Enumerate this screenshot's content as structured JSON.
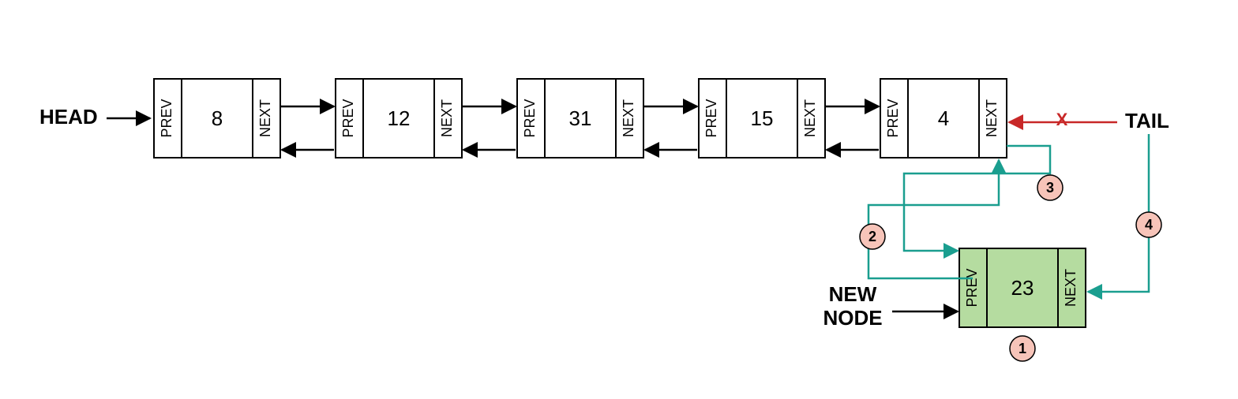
{
  "labels": {
    "head": "HEAD",
    "tail": "TAIL",
    "newNode1": "NEW",
    "newNode2": "NODE",
    "prev": "PREV",
    "next": "NEXT",
    "cross": "X"
  },
  "nodes": {
    "n0": "8",
    "n1": "12",
    "n2": "31",
    "n3": "15",
    "n4": "4",
    "new": "23"
  },
  "steps": {
    "s1": "1",
    "s2": "2",
    "s3": "3",
    "s4": "4"
  }
}
